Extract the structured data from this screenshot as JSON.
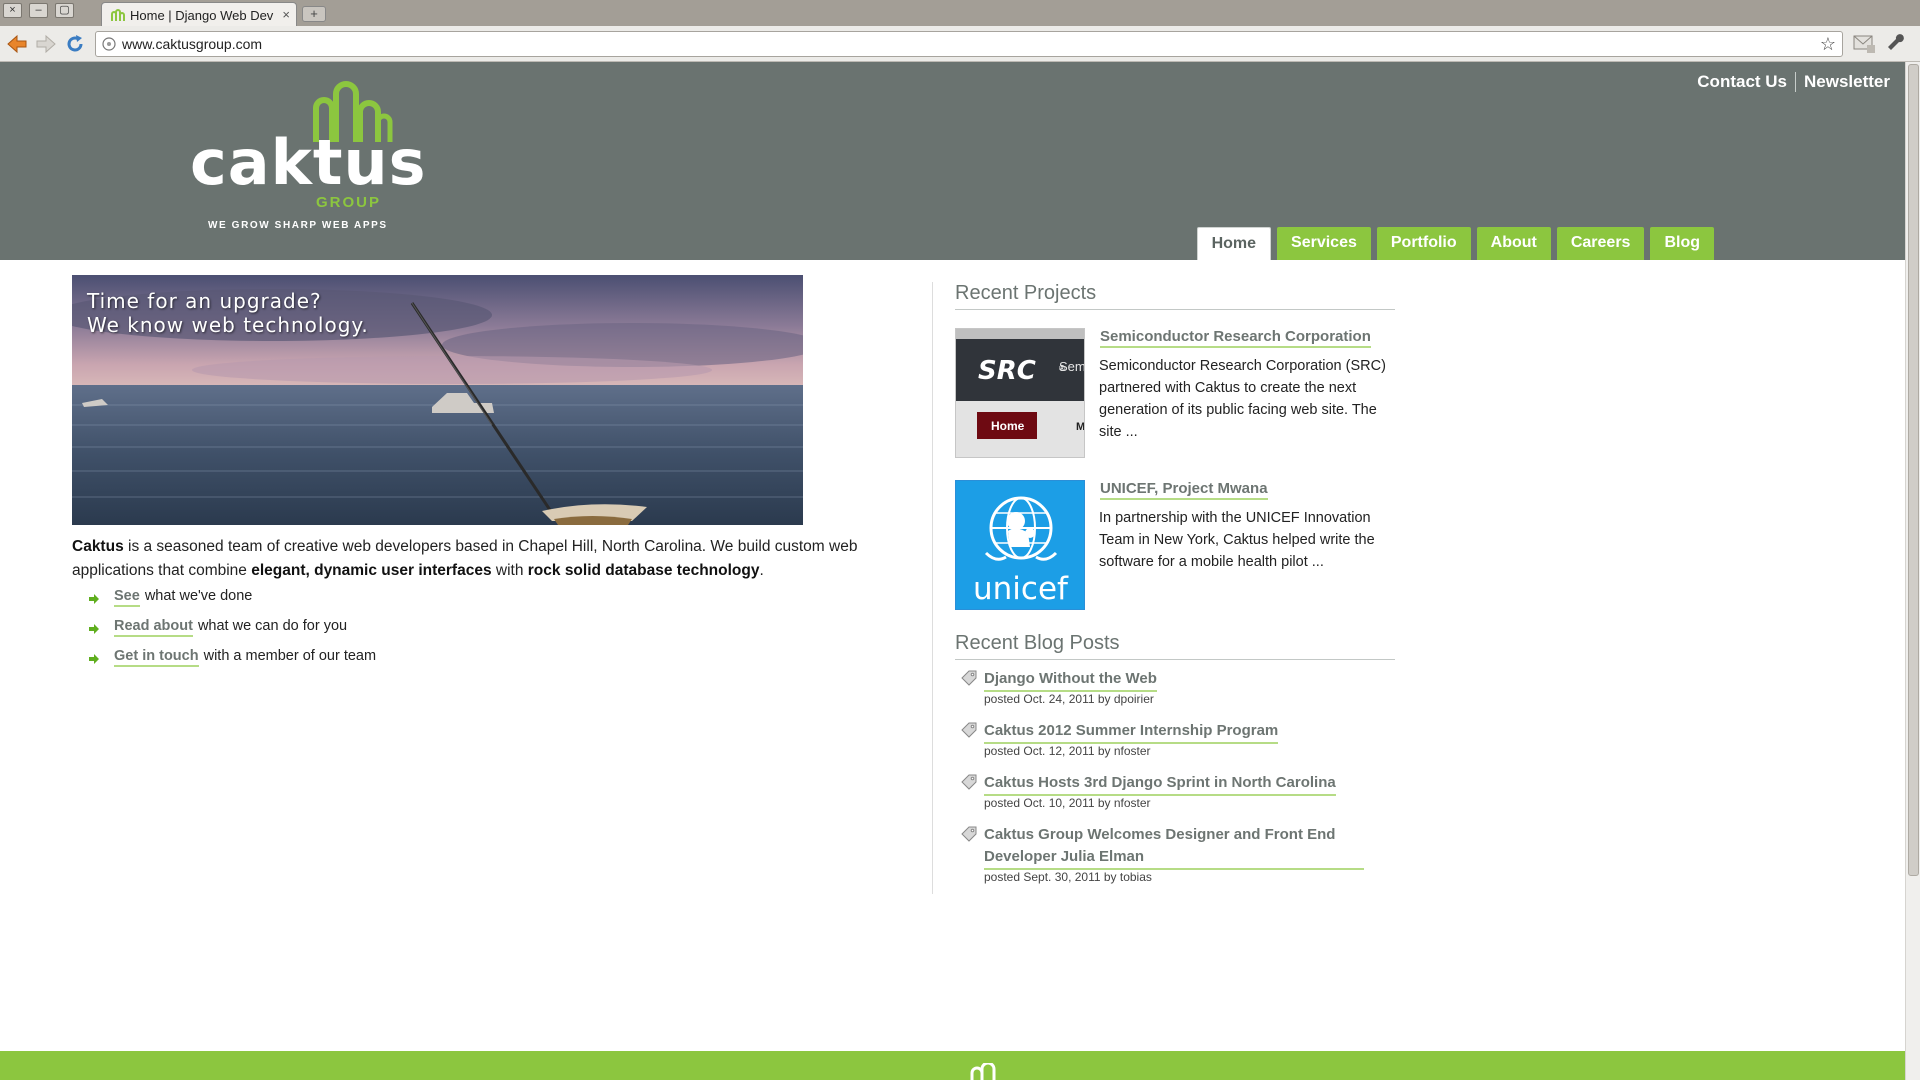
{
  "browser": {
    "tab_title": "Home | Django Web Dev",
    "tab_close": "×",
    "new_tab": "+",
    "url": "www.caktusgroup.com",
    "window_buttons": [
      "×",
      "–",
      "▢"
    ]
  },
  "site": {
    "logo": {
      "wordmark": "caktus",
      "group": "GROUP",
      "tagline": "WE GROW SHARP WEB APPS"
    },
    "util_links": [
      "Contact Us",
      "Newsletter"
    ],
    "nav": [
      "Home",
      "Services",
      "Portfolio",
      "About",
      "Careers",
      "Blog"
    ],
    "active_nav": "Home",
    "colors": {
      "header": "#6a7370",
      "accent": "#8cc63f",
      "link": "#6d7572"
    }
  },
  "hero": {
    "line1": "Time for an upgrade?",
    "line2": "We know web technology."
  },
  "intro": {
    "p1": "Caktus",
    "p2": " is a seasoned team of creative web developers based in Chapel Hill, North Carolina. We build custom web applications that combine ",
    "p3": "elegant, dynamic user interfaces",
    "p4": " with ",
    "p5": "rock solid database technology",
    "p6": "."
  },
  "bullets": [
    {
      "link": "See",
      "text": "what we've done"
    },
    {
      "link": "Read about",
      "text": "what we can do for you"
    },
    {
      "link": "Get in touch",
      "text": "with a member of our team"
    }
  ],
  "recent_projects": {
    "title": "Recent Projects",
    "items": [
      {
        "title": "Semiconductor Research Corporation",
        "desc": "Semiconductor Research Corporation (SRC) partnered with Caktus to create the next generation of its public facing web site. The site ...",
        "thumb_logo": "SRC",
        "thumb_text": "Sem",
        "thumb_button": "Home",
        "thumb_m": "M"
      },
      {
        "title": "UNICEF, Project Mwana",
        "desc": "In partnership with the UNICEF Innovation Team in New York, Caktus helped write the software for a mobile health pilot ...",
        "thumb_text": "unicef"
      }
    ]
  },
  "recent_posts": {
    "title": "Recent Blog Posts",
    "items": [
      {
        "title": "Django Without the Web",
        "meta": "posted Oct. 24, 2011 by dpoirier"
      },
      {
        "title": "Caktus 2012 Summer Internship Program",
        "meta": "posted Oct. 12, 2011 by nfoster"
      },
      {
        "title": "Caktus Hosts 3rd Django Sprint in North Carolina",
        "meta": "posted Oct. 10, 2011 by nfoster"
      },
      {
        "title": "Caktus Group Welcomes Designer and Front End Developer Julia Elman",
        "meta": "posted Sept. 30, 2011 by tobias"
      }
    ]
  }
}
